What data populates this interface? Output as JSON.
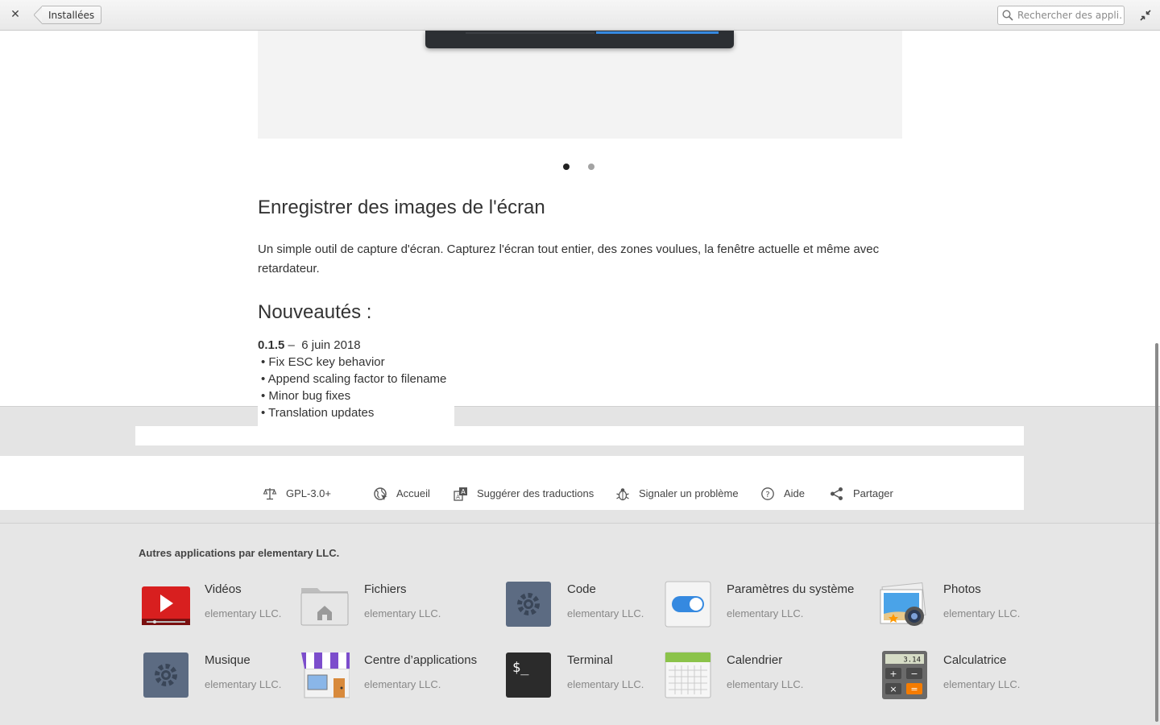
{
  "header": {
    "close_icon": "close-icon",
    "back_label": "Installées",
    "search_placeholder": "Rechercher des appli…",
    "restore_icon": "restore-icon"
  },
  "carousel": {
    "pages": 2,
    "active_page": 1
  },
  "app": {
    "summary": "Enregistrer des images de l'écran",
    "description": "Un simple outil de capture d'écran. Capturez l'écran tout entier, des zones voulues, la fenêtre actuelle et même avec retardateur.",
    "whats_new_title": "Nouveautés :",
    "release": {
      "version": "0.1.5",
      "separator": " –  ",
      "date": "6 juin 2018",
      "notes": [
        "Fix ESC key behavior",
        "Append scaling factor to filename",
        "Minor bug fixes",
        "Translation updates"
      ]
    }
  },
  "links": {
    "license": "GPL-3.0+",
    "homepage": "Accueil",
    "translate": "Suggérer des traductions",
    "bug": "Signaler un problème",
    "help": "Aide",
    "share": "Partager"
  },
  "other_apps": {
    "title": "Autres applications par elementary LLC.",
    "developer": "elementary LLC.",
    "apps": [
      {
        "name": "Vidéos",
        "developer": "elementary LLC.",
        "icon": "videos-icon"
      },
      {
        "name": "Fichiers",
        "developer": "elementary LLC.",
        "icon": "files-icon"
      },
      {
        "name": "Code",
        "developer": "elementary LLC.",
        "icon": "code-icon"
      },
      {
        "name": "Paramètres du système",
        "developer": "elementary LLC.",
        "icon": "settings-icon"
      },
      {
        "name": "Photos",
        "developer": "elementary LLC.",
        "icon": "photos-icon"
      },
      {
        "name": "Musique",
        "developer": "elementary LLC.",
        "icon": "music-icon"
      },
      {
        "name": "Centre d’applications",
        "developer": "elementary LLC.",
        "icon": "appcenter-icon"
      },
      {
        "name": "Terminal",
        "developer": "elementary LLC.",
        "icon": "terminal-icon"
      },
      {
        "name": "Calendrier",
        "developer": "elementary LLC.",
        "icon": "calendar-icon"
      },
      {
        "name": "Calculatrice",
        "developer": "elementary LLC.",
        "icon": "calculator-icon"
      }
    ],
    "calculator_display": "3.14"
  },
  "colors": {
    "accent_blue": "#3589e0",
    "video_red": "#e02828",
    "terminal_dark": "#2b2b2b",
    "calendar_green": "#8bc34a",
    "appcenter_purple": "#7c4dcc"
  }
}
